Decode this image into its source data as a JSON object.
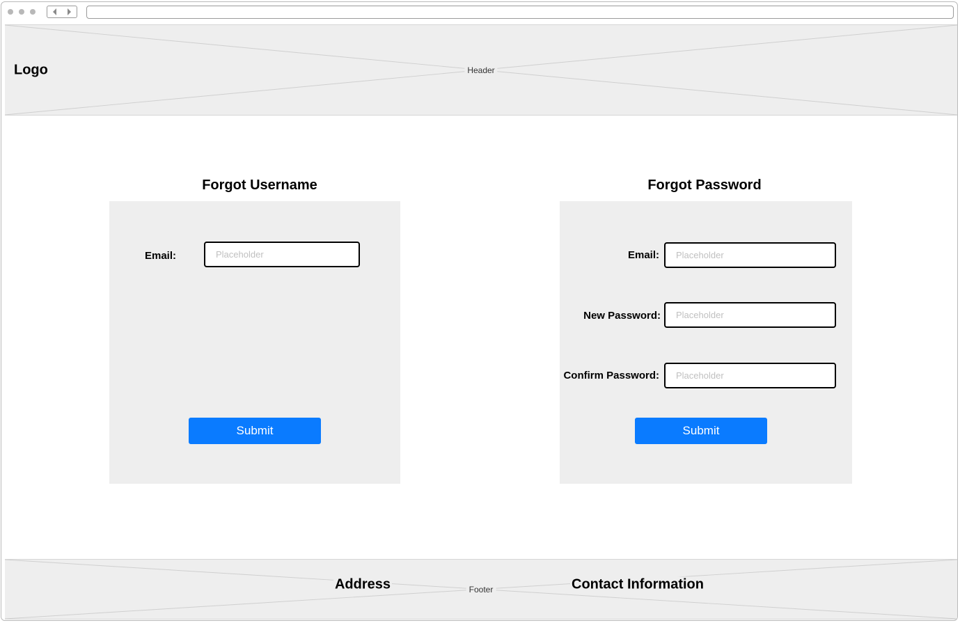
{
  "browser": {
    "back_icon": "chevron-left-icon",
    "forward_icon": "chevron-right-icon",
    "address": ""
  },
  "header": {
    "logo": "Logo",
    "label": "Header"
  },
  "forgot_username": {
    "title": "Forgot Username",
    "email_label": "Email:",
    "email_placeholder": "Placeholder",
    "submit_label": "Submit"
  },
  "forgot_password": {
    "title": "Forgot Password",
    "email_label": "Email:",
    "email_placeholder": "Placeholder",
    "new_password_label": "New Password:",
    "new_password_placeholder": "Placeholder",
    "confirm_password_label": "Confirm Password:",
    "confirm_password_placeholder": "Placeholder",
    "submit_label": "Submit"
  },
  "footer": {
    "label": "Footer",
    "address": "Address",
    "contact": "Contact Information"
  },
  "colors": {
    "primary_button": "#0a7bff",
    "placeholder_fill": "#eeeeee"
  }
}
